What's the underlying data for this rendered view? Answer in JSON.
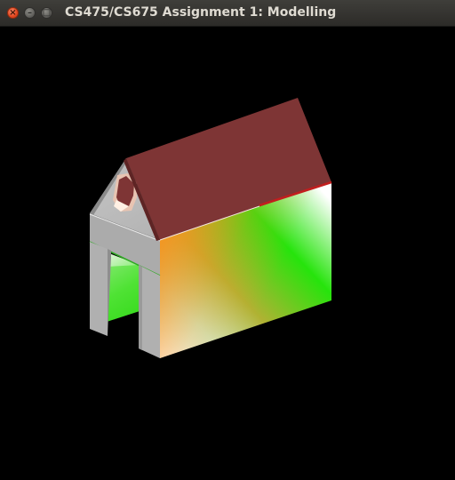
{
  "window": {
    "title": "CS475/CS675 Assignment 1: Modelling",
    "buttons": {
      "close_glyph": "×",
      "minimize_glyph": "–",
      "maximize_glyph": "□"
    }
  },
  "scene": {
    "background": "#000000",
    "colors": {
      "roof": "#7e3535",
      "roof_edge": "#c21e1e",
      "wall_gray": "#b3b3b3",
      "wall_green": "#26e40c",
      "wall_orange": "#f5941f",
      "wall_white": "#ffffff"
    }
  }
}
